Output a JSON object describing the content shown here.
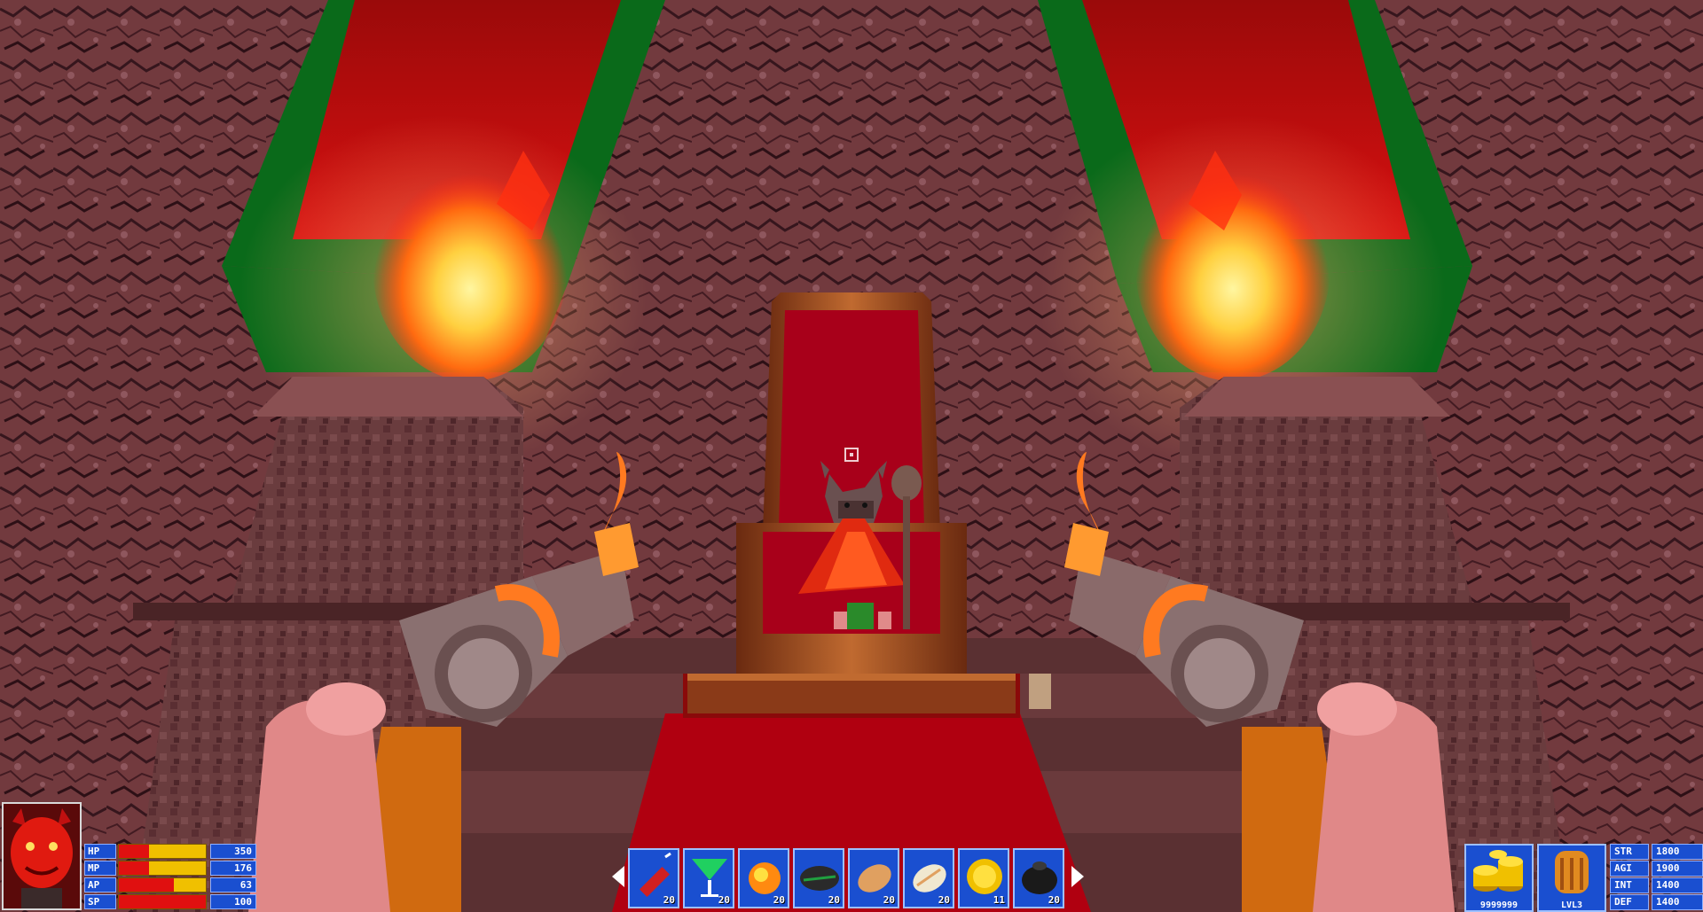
{
  "stats": [
    {
      "label": "HP",
      "value": "350",
      "fill": 0.35
    },
    {
      "label": "MP",
      "value": "176",
      "fill": 0.35
    },
    {
      "label": "AP",
      "value": "63",
      "fill": 0.63
    },
    {
      "label": "SP",
      "value": "100",
      "fill": 1.0
    }
  ],
  "hotbar": {
    "items": [
      {
        "icon": "dynamite-icon",
        "count": "20"
      },
      {
        "icon": "cocktail-glass-icon",
        "count": "20"
      },
      {
        "icon": "fire-orb-icon",
        "count": "20"
      },
      {
        "icon": "dark-bomb-icon",
        "count": "20"
      },
      {
        "icon": "bread-loaf-icon",
        "count": "20"
      },
      {
        "icon": "white-bread-icon",
        "count": "20"
      },
      {
        "icon": "gold-coin-icon",
        "count": "11"
      },
      {
        "icon": "black-pouch-icon",
        "count": "20"
      }
    ]
  },
  "gold": {
    "value": "9999999",
    "icon": "gold-coins-icon"
  },
  "level": {
    "value": "LVL3",
    "icon": "door-icon"
  },
  "attributes": [
    {
      "label": "STR",
      "value": "1800"
    },
    {
      "label": "AGI",
      "value": "1900"
    },
    {
      "label": "INT",
      "value": "1400"
    },
    {
      "label": "DEF",
      "value": "1400"
    }
  ],
  "colors": {
    "hud_blue": "#1a4fd0",
    "hud_border": "#9ec0ff",
    "bar_red": "#e01010",
    "bar_yellow": "#f0c000",
    "banner_red": "#c01010",
    "banner_green": "#0a6a1a",
    "carpet_red": "#b00010"
  }
}
